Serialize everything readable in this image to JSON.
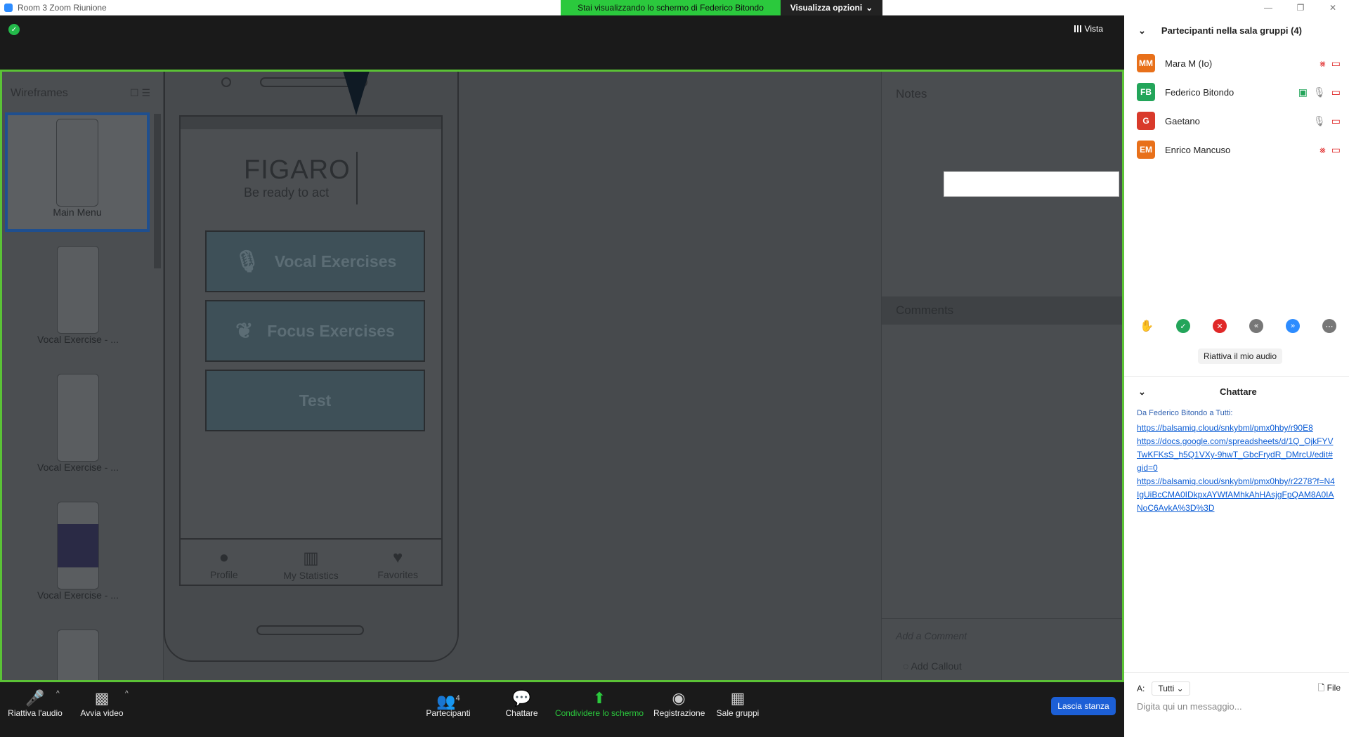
{
  "window": {
    "title": "Room 3   Zoom Riunione",
    "controls": [
      "—",
      "❐",
      "✕"
    ]
  },
  "banner": {
    "viewing_text": "Stai visualizzando lo schermo di Federico Bitondo",
    "options_label": "Visualizza opzioni"
  },
  "meeting": {
    "view_label": "Vista"
  },
  "shared": {
    "wireframes_title": "Wireframes",
    "thumbs": [
      "Main Menu",
      "Vocal Exercise - ...",
      "Vocal Exercise - ...",
      "Vocal Exercise - ..."
    ],
    "app": {
      "logo_name": "FIGARO",
      "logo_tagline": "Be ready to act",
      "buttons": [
        "Vocal Exercises",
        "Focus Exercises",
        "Test"
      ],
      "tabs": [
        "Profile",
        "My Statistics",
        "Favorites"
      ]
    },
    "notes_title": "Notes",
    "comments_title": "Comments",
    "add_comment": "Add a Comment",
    "add_callout": "Add Callout"
  },
  "toolbar": {
    "audio": "Riattiva l'audio",
    "video": "Avvia video",
    "participants": "Partecipanti",
    "participants_count": "4",
    "chat": "Chattare",
    "share": "Condividere lo schermo",
    "record": "Registrazione",
    "breakout": "Sale gruppi",
    "leave": "Lascia stanza"
  },
  "sidebar": {
    "participants_title": "Partecipanti nella sala gruppi (4)",
    "participants": [
      {
        "initials": "MM",
        "name": "Mara M (Io)",
        "color": "#e8701a"
      },
      {
        "initials": "FB",
        "name": "Federico Bitondo",
        "color": "#23a55a"
      },
      {
        "initials": "G",
        "name": "Gaetano",
        "color": "#d93a2b"
      },
      {
        "initials": "EM",
        "name": "Enrico Mancuso",
        "color": "#e8701a"
      }
    ],
    "unmute_label": "Riattiva il mio audio",
    "chat_title": "Chattare",
    "chat_from_prefix": "Da ",
    "chat_sender": "Federico Bitondo",
    "chat_to": " a Tutti:",
    "chat_links": [
      "https://balsamiq.cloud/snkybml/pmx0hby/r90E8",
      "https://docs.google.com/spreadsheets/d/1Q_OjkFYVTwKFKsS_h5Q1VXy-9hwT_GbcFrydR_DMrcU/edit#gid=0",
      "https://balsamiq.cloud/snkybml/pmx0hby/r2278?f=N4IgUiBcCMA0IDkpxAYWfAMhkAhHAsjgFpQAM8A0IANoC6AvkA%3D%3D"
    ],
    "to_label": "A:",
    "to_value": "Tutti",
    "file_label": "File",
    "message_placeholder": "Digita qui un messaggio..."
  }
}
